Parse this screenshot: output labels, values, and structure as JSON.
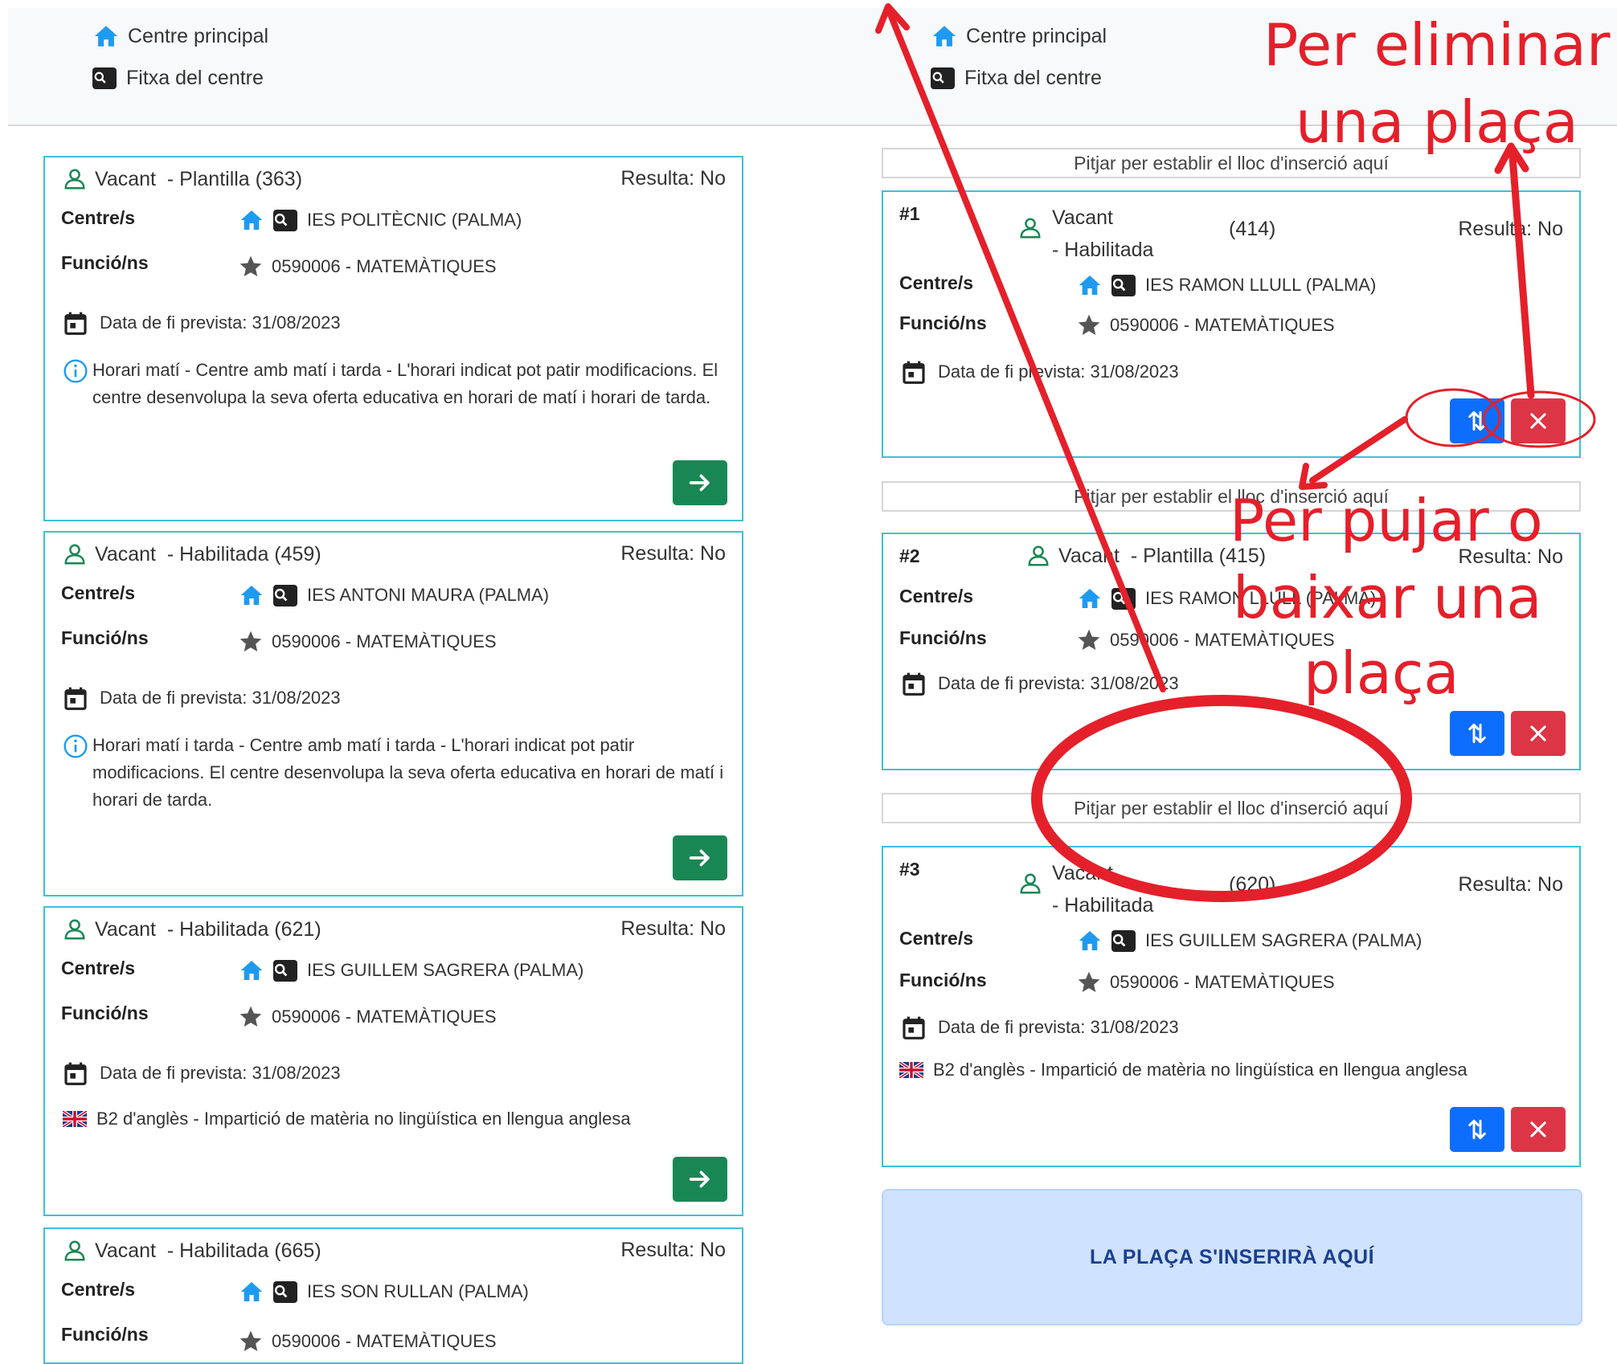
{
  "legend": {
    "home_label": "Centre principal",
    "file_label": "Fitxa del centre"
  },
  "left_cards": [
    {
      "vacancy": "Vacant",
      "type": "- Plantilla (363)",
      "result": "Resulta: No",
      "centre_label": "Centre/s",
      "centre": "IES POLITÈCNIC (PALMA)",
      "function_label": "Funció/ns",
      "function": "0590006 - MATEMÀTIQUES",
      "end_date": "Data de fi prevista: 31/08/2023",
      "info": "Horari matí - Centre amb matí i tarda - L'horari indicat pot patir modificacions. El centre desenvolupa la seva oferta educativa en horari de matí i horari de tarda."
    },
    {
      "vacancy": "Vacant",
      "type": "- Habilitada (459)",
      "result": "Resulta: No",
      "centre_label": "Centre/s",
      "centre": "IES ANTONI MAURA (PALMA)",
      "function_label": "Funció/ns",
      "function": "0590006 - MATEMÀTIQUES",
      "end_date": "Data de fi prevista: 31/08/2023",
      "info": "Horari matí i tarda - Centre amb matí i tarda - L'horari indicat pot patir modificacions. El centre desenvolupa la seva oferta educativa en horari de matí i horari de tarda."
    },
    {
      "vacancy": "Vacant",
      "type": "- Habilitada (621)",
      "result": "Resulta: No",
      "centre_label": "Centre/s",
      "centre": "IES GUILLEM SAGRERA (PALMA)",
      "function_label": "Funció/ns",
      "function": "0590006 - MATEMÀTIQUES",
      "end_date": "Data de fi prevista: 31/08/2023",
      "language": "B2 d'anglès - Impartició de matèria no lingüística en llengua anglesa"
    },
    {
      "vacancy": "Vacant",
      "type": "- Habilitada (665)",
      "result": "Resulta: No",
      "centre_label": "Centre/s",
      "centre": "IES SON RULLAN (PALMA)",
      "function_label": "Funció/ns",
      "function": "0590006 - MATEMÀTIQUES"
    }
  ],
  "insertion_label": "Pitjar per establir el lloc d'inserció aquí",
  "right_cards": [
    {
      "num": "#1",
      "vacancy": "Vacant",
      "type": "- Habilitada",
      "code": "(414)",
      "result": "Resulta: No",
      "centre_label": "Centre/s",
      "centre": "IES RAMON LLULL (PALMA)",
      "function_label": "Funció/ns",
      "function": "0590006 - MATEMÀTIQUES",
      "end_date": "Data de fi prevista: 31/08/2023"
    },
    {
      "num": "#2",
      "vacancy": "Vacant",
      "type": "- Plantilla (415)",
      "result": "Resulta: No",
      "centre_label": "Centre/s",
      "centre": "IES RAMON LLULL (PALMA)",
      "function_label": "Funció/ns",
      "function": "0590006 - MATEMÀTIQUES",
      "end_date": "Data de fi prevista: 31/08/2023"
    },
    {
      "num": "#3",
      "vacancy": "Vacant",
      "type": "- Habilitada",
      "code": "(620)",
      "result": "Resulta: No",
      "centre_label": "Centre/s",
      "centre": "IES GUILLEM SAGRERA (PALMA)",
      "function_label": "Funció/ns",
      "function": "0590006 - MATEMÀTIQUES",
      "end_date": "Data de fi prevista: 31/08/2023",
      "language": "B2 d'anglès - Impartició de matèria no lingüística en llengua anglesa"
    }
  ],
  "insert_here": "LA PLAÇA S'INSERIRÀ AQUÍ",
  "annotations": {
    "delete_line1": "Per eliminar",
    "delete_line2": "una plaça",
    "move_line1": "Per pujar o",
    "move_line2": "baixar una",
    "move_line3": "plaça"
  },
  "colors": {
    "card_border": "#3cc1d8",
    "annotation": "#e4202a",
    "green_button": "#198754",
    "blue_button": "#0d6efd",
    "red_button": "#dc3545"
  }
}
